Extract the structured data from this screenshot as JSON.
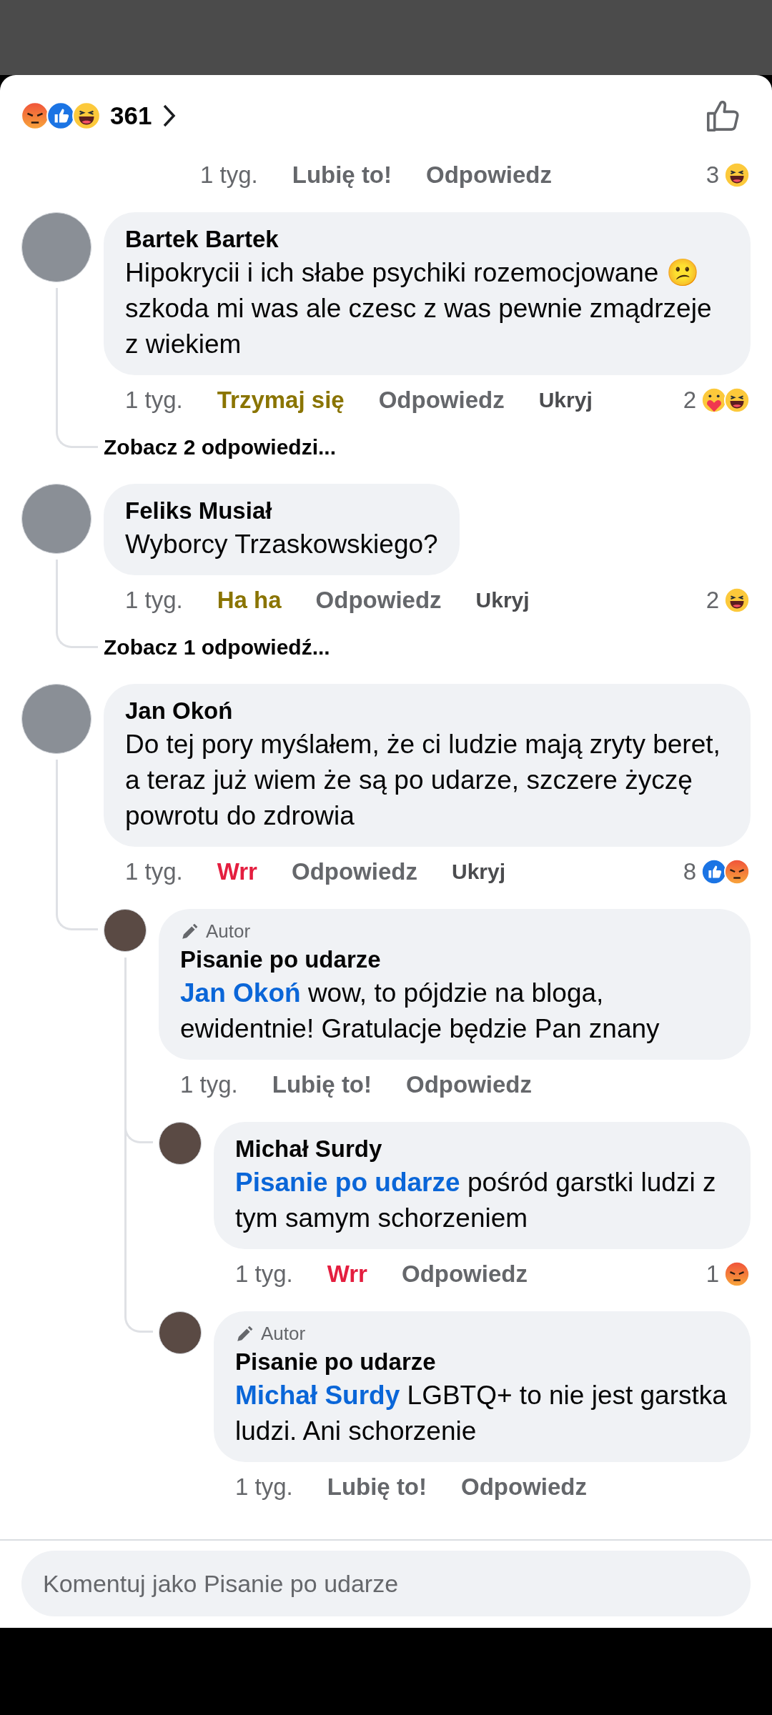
{
  "header": {
    "reaction_kinds": [
      {
        "kind": "angry"
      },
      {
        "kind": "like"
      },
      {
        "kind": "haha"
      }
    ],
    "count": "361"
  },
  "previous_actions": {
    "time": "1 tyg.",
    "reaction": {
      "label": "Lubię to!",
      "kind": "none"
    },
    "reply": "Odpowiedz",
    "reactions": {
      "count": "3",
      "kinds": [
        {
          "kind": "haha"
        }
      ]
    }
  },
  "comments": [
    {
      "name": "Bartek Bartek",
      "text": "Hipokrycii i ich słabe psychiki rozemocjowane 😕 szkoda mi was ale czesc z was pewnie zmądrzeje z wiekiem",
      "time": "1 tyg.",
      "reaction": {
        "label": "Trzymaj się",
        "kind": "care"
      },
      "reply": "Odpowiedz",
      "hide": "Ukryj",
      "reactions": {
        "count": "2",
        "kinds": [
          {
            "kind": "care"
          },
          {
            "kind": "haha"
          }
        ]
      },
      "more_replies": "Zobacz 2 odpowiedzi..."
    },
    {
      "name": "Feliks Musiał",
      "text": "Wyborcy Trzaskowskiego?",
      "time": "1 tyg.",
      "reaction": {
        "label": "Ha ha",
        "kind": "haha"
      },
      "reply": "Odpowiedz",
      "hide": "Ukryj",
      "reactions": {
        "count": "2",
        "kinds": [
          {
            "kind": "haha"
          }
        ]
      },
      "more_replies": "Zobacz 1 odpowiedź..."
    },
    {
      "name": "Jan Okoń",
      "text": "Do tej pory myślałem, że ci ludzie mają zryty beret, a teraz już wiem że są po udarze, szczere życzę powrotu do zdrowia",
      "time": "1 tyg.",
      "reaction": {
        "label": "Wrr",
        "kind": "angry"
      },
      "reply": "Odpowiedz",
      "hide": "Ukryj",
      "reactions": {
        "count": "8",
        "kinds": [
          {
            "kind": "like"
          },
          {
            "kind": "angry"
          }
        ]
      },
      "children": [
        {
          "badge": "Autor",
          "name": "Pisanie po udarze",
          "mention": "Jan Okoń",
          "text": "wow, to pójdzie na bloga, ewidentnie! Gratulacje będzie Pan znany",
          "time": "1 tyg.",
          "reaction": {
            "label": "Lubię to!",
            "kind": "none"
          },
          "reply": "Odpowiedz",
          "children": [
            {
              "name": "Michał Surdy",
              "mention": "Pisanie po udarze",
              "text": "pośród garstki ludzi z tym samym schorzeniem",
              "time": "1 tyg.",
              "reaction": {
                "label": "Wrr",
                "kind": "angry"
              },
              "reply": "Odpowiedz",
              "reactions": {
                "count": "1",
                "kinds": [
                  {
                    "kind": "angry"
                  }
                ]
              }
            },
            {
              "badge": "Autor",
              "name": "Pisanie po udarze",
              "mention": "Michał Surdy",
              "text": "LGBTQ+ to nie jest garstka ludzi. Ani schorzenie",
              "time": "1 tyg.",
              "reaction": {
                "label": "Lubię to!",
                "kind": "none"
              },
              "reply": "Odpowiedz"
            }
          ]
        }
      ]
    }
  ],
  "composer": {
    "placeholder": "Komentuj jako Pisanie po udarze"
  }
}
